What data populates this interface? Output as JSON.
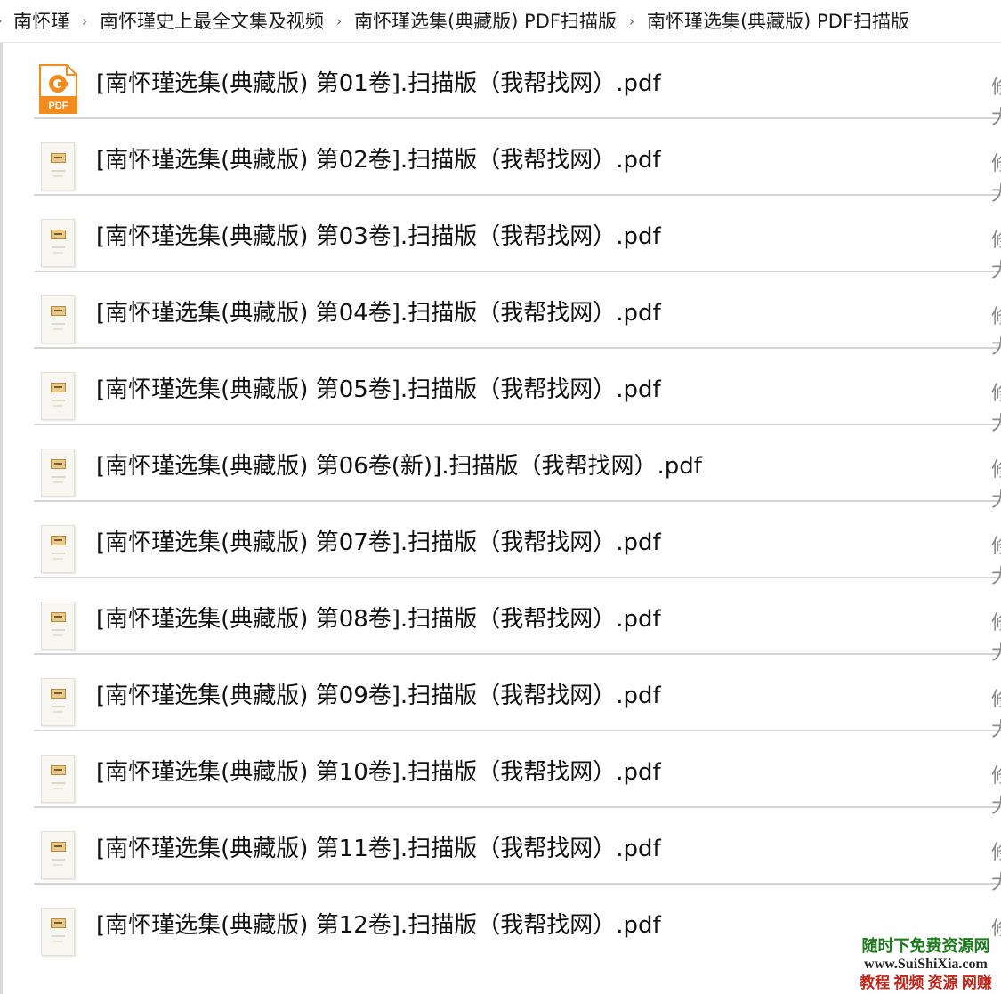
{
  "breadcrumb": {
    "lead": "›",
    "items": [
      {
        "label": "南怀瑾"
      },
      {
        "label": "南怀瑾史上最全文集及视频"
      },
      {
        "label": "南怀瑾选集(典藏版) PDF扫描版"
      },
      {
        "label": "南怀瑾选集(典藏版) PDF扫描版"
      }
    ],
    "separator": "›"
  },
  "files": [
    {
      "name": "[南怀瑾选集(典藏版) 第01卷].扫描版（我帮找网）.pdf",
      "icon": "pdf-app-icon",
      "edge_top": "修",
      "edge_bottom": "大"
    },
    {
      "name": "[南怀瑾选集(典藏版) 第02卷].扫描版（我帮找网）.pdf",
      "icon": "pdf-thumbnail-icon",
      "edge_top": "修",
      "edge_bottom": "大"
    },
    {
      "name": "[南怀瑾选集(典藏版) 第03卷].扫描版（我帮找网）.pdf",
      "icon": "pdf-thumbnail-icon",
      "edge_top": "修",
      "edge_bottom": "大"
    },
    {
      "name": "[南怀瑾选集(典藏版) 第04卷].扫描版（我帮找网）.pdf",
      "icon": "pdf-thumbnail-icon",
      "edge_top": "修",
      "edge_bottom": "大"
    },
    {
      "name": "[南怀瑾选集(典藏版) 第05卷].扫描版（我帮找网）.pdf",
      "icon": "pdf-thumbnail-icon",
      "edge_top": "修",
      "edge_bottom": "大"
    },
    {
      "name": "[南怀瑾选集(典藏版) 第06卷(新)].扫描版（我帮找网）.pdf",
      "icon": "pdf-thumbnail-icon",
      "edge_top": "修",
      "edge_bottom": "大"
    },
    {
      "name": "[南怀瑾选集(典藏版) 第07卷].扫描版（我帮找网）.pdf",
      "icon": "pdf-thumbnail-icon",
      "edge_top": "修",
      "edge_bottom": "大"
    },
    {
      "name": "[南怀瑾选集(典藏版) 第08卷].扫描版（我帮找网）.pdf",
      "icon": "pdf-thumbnail-icon",
      "edge_top": "修",
      "edge_bottom": "大"
    },
    {
      "name": "[南怀瑾选集(典藏版) 第09卷].扫描版（我帮找网）.pdf",
      "icon": "pdf-thumbnail-icon",
      "edge_top": "修",
      "edge_bottom": "大"
    },
    {
      "name": "[南怀瑾选集(典藏版) 第10卷].扫描版（我帮找网）.pdf",
      "icon": "pdf-thumbnail-icon",
      "edge_top": "修",
      "edge_bottom": "大"
    },
    {
      "name": "[南怀瑾选集(典藏版) 第11卷].扫描版（我帮找网）.pdf",
      "icon": "pdf-thumbnail-icon",
      "edge_top": "修",
      "edge_bottom": "大"
    },
    {
      "name": "[南怀瑾选集(典藏版) 第12卷].扫描版（我帮找网）.pdf",
      "icon": "pdf-thumbnail-icon",
      "edge_top": "修",
      "edge_bottom": ""
    }
  ],
  "watermark": {
    "line1": "随时下免费资源网",
    "line2": "www.SuiShiXia.com",
    "line3": "教程 视频 资源 网赚"
  },
  "colors": {
    "pdf_orange": "#f28c1e",
    "divider": "#d4d4d4",
    "watermark_green": "#1d7a1d",
    "watermark_red": "#c0261c"
  }
}
